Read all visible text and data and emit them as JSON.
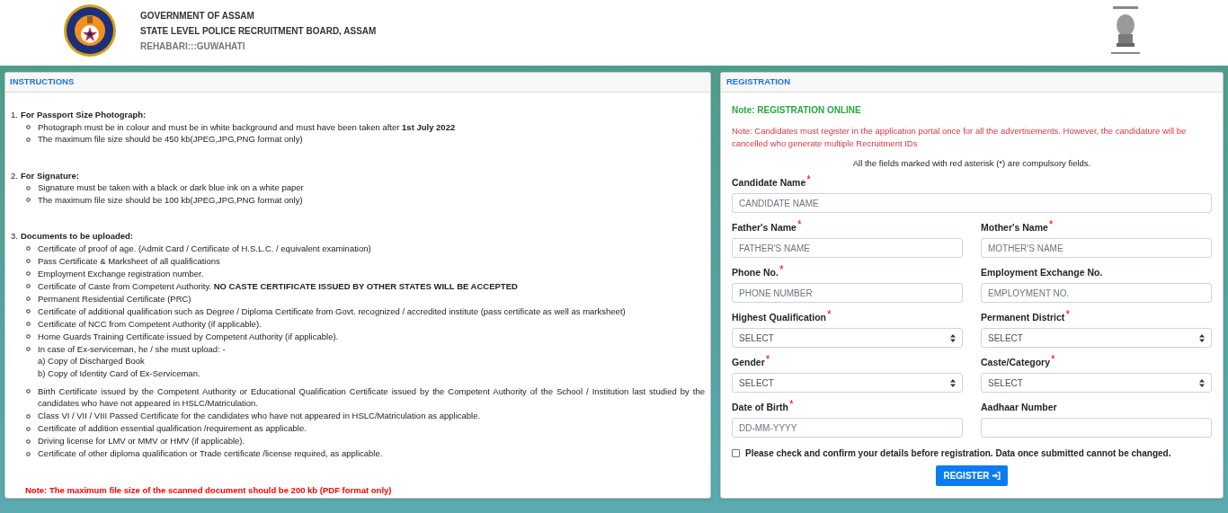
{
  "header": {
    "lines": [
      "GOVERNMENT OF ASSAM",
      "STATE LEVEL POLICE RECRUITMENT BOARD, ASSAM"
    ],
    "subtitle": "REHABARI:::GUWAHATI"
  },
  "instructions": {
    "title": "INSTRUCTIONS",
    "sections": [
      {
        "number": "1.",
        "heading": "For Passport Size Photograph:",
        "items": [
          {
            "text": "Photograph must be in colour and must be in white background and must have been taken after **1st July 2022**"
          },
          {
            "text": "The maximum file size should be 450 kb(JPEG,JPG,PNG format only)"
          }
        ]
      },
      {
        "number": "2.",
        "heading": "For Signature:",
        "items": [
          {
            "text": "Signature must be taken with a black or dark blue ink on a white paper"
          },
          {
            "text": "The maximum file size should be 100 kb(JPEG,JPG,PNG format only)"
          }
        ]
      },
      {
        "number": "3.",
        "heading": "Documents to be uploaded:",
        "items": [
          {
            "text": "Certificate of proof of age. (Admit Card / Certificate of H.S.L.C. / equivalent examination)"
          },
          {
            "text": "Pass Certificate & Marksheet of all qualifications"
          },
          {
            "text": "Employment Exchange registration number."
          },
          {
            "text": "Certificate of Caste from Competent Authority. **NO CASTE CERTIFICATE ISSUED BY OTHER STATES WILL BE ACCEPTED**"
          },
          {
            "text": "Permanent Residential Certificate (PRC)"
          },
          {
            "text": "Certificate of additional qualification such as Degree / Diploma Certificate from Govt. recognized / accredited institute (pass certificate as well as marksheet)"
          },
          {
            "text": "Certificate of NCC from Competent Authority (if applicable)."
          },
          {
            "text": "Home Guards Training Certificate issued by Competent Authority (if applicable)."
          },
          {
            "text": "In case of Ex-serviceman, he / she must upload: -",
            "lines": [
              "a) Copy of Discharged Book",
              "b) Copy of Identity Card of Ex-Serviceman."
            ]
          },
          {
            "text": "Birth Certificate issued by the Competent Authority or Educational Qualification Certificate issued by the Competent Authority of the School / Institution last studied by the candidates who have not appeared in HSLC/Matriculation."
          },
          {
            "text": "Class VI / VII / VIII Passed Certificate for the candidates who have not appeared in HSLC/Matriculation as applicable."
          },
          {
            "text": "Certificate of addition essential qualification /requirement as applicable."
          },
          {
            "text": "Driving license for LMV or MMV or HMV (if applicable)."
          },
          {
            "text": "Certificate of other diploma qualification or Trade certificate /license required, as applicable."
          }
        ]
      }
    ],
    "note": "Note: The maximum file size of the scanned document should be 200 kb (PDF format only)"
  },
  "registration": {
    "title": "REGISTRATION",
    "note_online": "Note: REGISTRATION ONLINE",
    "note_warning": "Note: Candidates must register in the application portal once for all the advertisements. However, the candidature will be cancelled who generate multiple Recruitment IDs",
    "hint": "All the fields marked with red asterisk (*) are compulsory fields.",
    "fields": [
      {
        "label": "Candidate Name",
        "required_mark": "*",
        "kind": "text",
        "placeholder": "CANDIDATE NAME",
        "wide": true
      },
      {
        "label": "Father's Name",
        "required_mark": "*",
        "kind": "text",
        "placeholder": "FATHER'S NAME",
        "wide": false
      },
      {
        "label": "Mother's Name",
        "required_mark": "*",
        "kind": "text",
        "placeholder": "MOTHER'S NAME",
        "wide": false
      },
      {
        "label": "Phone No.",
        "required_mark": "*",
        "kind": "text",
        "placeholder": "PHONE NUMBER",
        "wide": false
      },
      {
        "label": "Employment Exchange No.",
        "kind": "text",
        "placeholder": "EMPLOYMENT NO.",
        "wide": false
      },
      {
        "label": "Highest Qualification",
        "required_mark": "*",
        "kind": "select",
        "value": "SELECT",
        "wide": false
      },
      {
        "label": "Permanent District",
        "required_mark": "*",
        "kind": "select",
        "value": "SELECT",
        "wide": false
      },
      {
        "label": "Gender",
        "required_mark": "*",
        "kind": "select",
        "value": "SELECT",
        "wide": false
      },
      {
        "label": "Caste/Category",
        "required_mark": "*",
        "kind": "select",
        "value": "SELECT",
        "wide": false
      },
      {
        "label": "Date of Birth",
        "required_mark": "*",
        "kind": "text",
        "placeholder": "DD-MM-YYYY",
        "wide": false
      },
      {
        "label": "Aadhaar Number",
        "kind": "text",
        "wide": false
      }
    ],
    "confirm": {
      "text": "Please check and confirm your details before registration. Data once submitted cannot be changed.",
      "checked": false
    },
    "register_button": "REGISTER"
  }
}
